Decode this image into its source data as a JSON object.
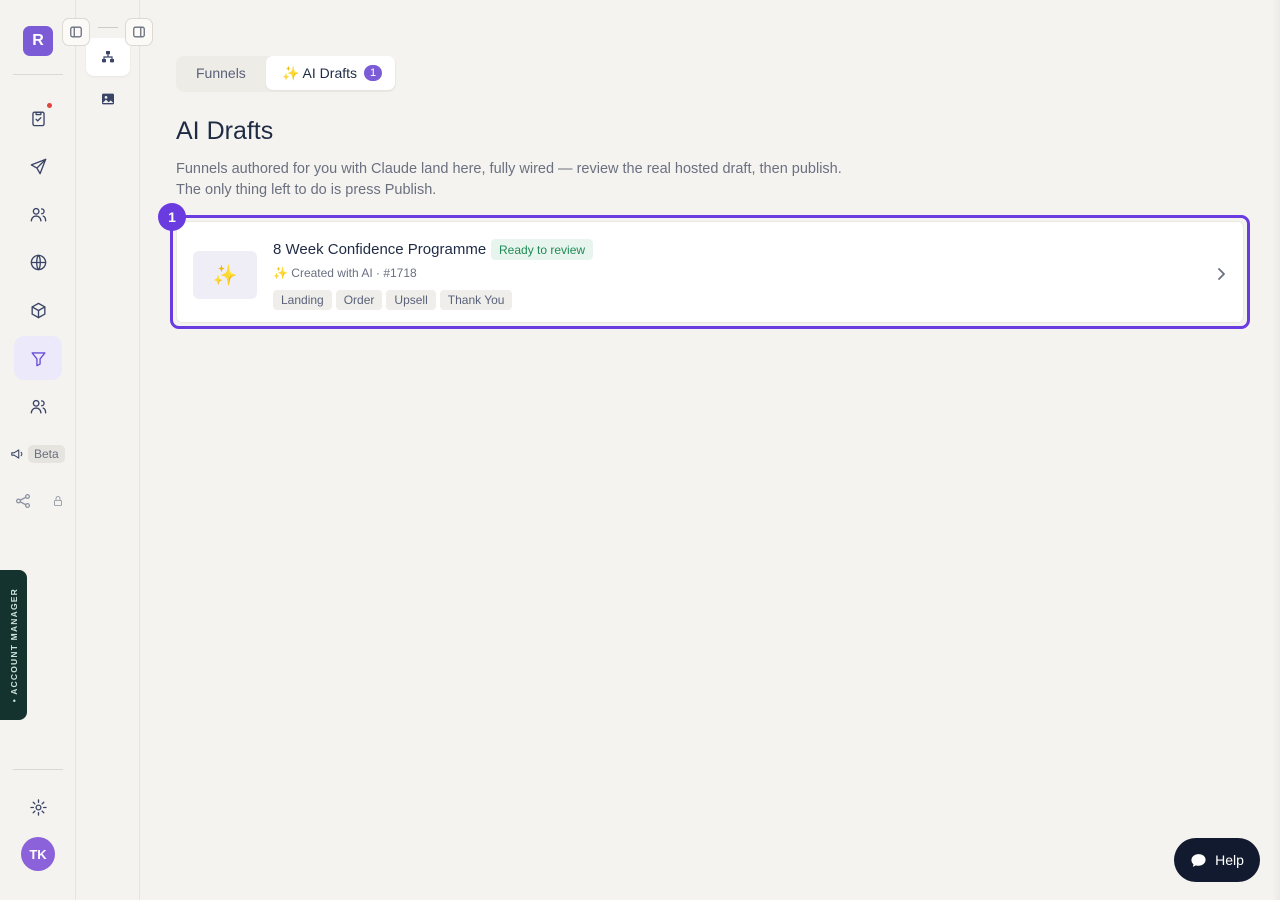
{
  "brand": {
    "letter": "R",
    "color": "#7b5cd6"
  },
  "rail": {
    "items": [
      {
        "name": "tasks",
        "icon": "clipboard-check-icon",
        "notification": true
      },
      {
        "name": "send",
        "icon": "paper-plane-icon"
      },
      {
        "name": "contacts",
        "icon": "users-icon"
      },
      {
        "name": "websites",
        "icon": "globe-icon"
      },
      {
        "name": "products",
        "icon": "box-icon"
      },
      {
        "name": "funnels",
        "icon": "funnel-icon",
        "active": true
      },
      {
        "name": "audience",
        "icon": "people-icon"
      }
    ],
    "beta_label": "Beta",
    "account_manager_label": "• ACCOUNT MANAGER",
    "avatar_initials": "TK"
  },
  "tabs": [
    {
      "label": "Funnels",
      "active": false
    },
    {
      "label": "✨ AI Drafts",
      "active": true,
      "count": "1"
    }
  ],
  "page": {
    "title": "AI Drafts",
    "description_line1": "Funnels authored for you with Claude land here, fully wired — review the real hosted draft, then publish.",
    "description_line2": "The only thing left to do is press Publish."
  },
  "draft_card": {
    "step_number": "1",
    "thumb_glyph": "✨",
    "title": "8 Week Confidence Programme",
    "status": "Ready to review",
    "meta": "✨ Created with AI · #1718",
    "steps": [
      "Landing",
      "Order",
      "Upsell",
      "Thank You"
    ]
  },
  "help": {
    "label": "Help"
  },
  "colors": {
    "accent": "#6a3ce0",
    "status_green": "#1f8a55",
    "help_bg": "#111a2e"
  }
}
